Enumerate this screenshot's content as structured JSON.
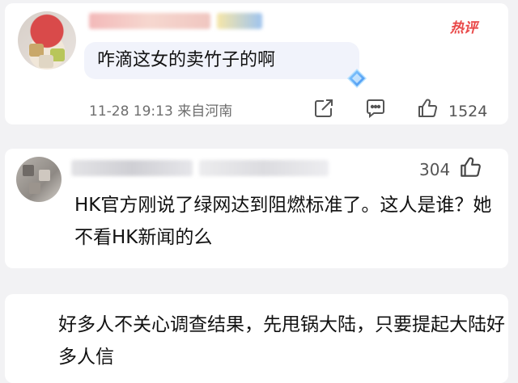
{
  "comments": [
    {
      "badge": "热评",
      "text": "咋滴这女的卖竹子的啊",
      "meta": "11-28 19:13 来自河南",
      "likes": "1524"
    },
    {
      "likes": "304",
      "text": "HK官方刚说了绿网达到阻燃标准了。这人是谁？她不看HK新闻的么"
    },
    {
      "text": "好多人不关心调查结果，先甩锅大陆，只要提起大陆好多人信"
    }
  ],
  "colors": {
    "hot_badge": "#e94848",
    "meta_text": "#6e6e6e",
    "bubble_bg": "#f1f3fb"
  },
  "icons": [
    "diamond-icon",
    "share-icon",
    "comment-icon",
    "like-icon"
  ]
}
